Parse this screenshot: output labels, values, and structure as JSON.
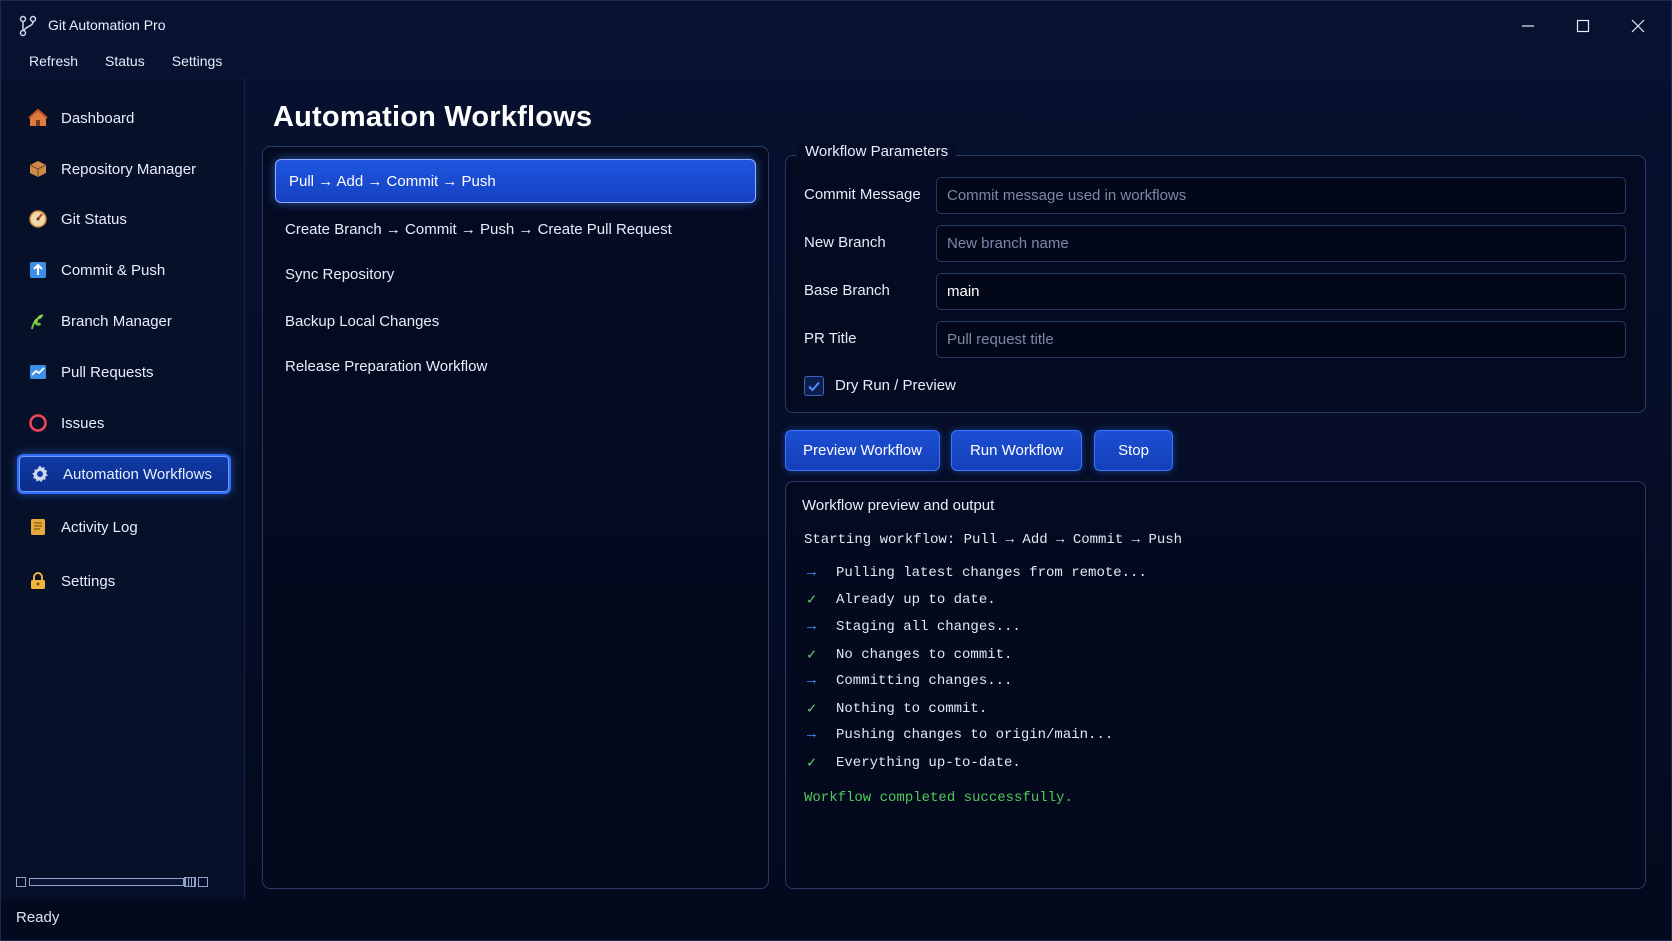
{
  "window": {
    "title": "Git Automation Pro",
    "minimize_icon": "minimize-icon",
    "maximize_icon": "maximize-icon",
    "close_icon": "close-icon"
  },
  "menu": [
    "Refresh",
    "Status",
    "Settings"
  ],
  "sidebar": {
    "items": [
      {
        "label": "Dashboard",
        "icon": "house-icon",
        "active": false
      },
      {
        "label": "Repository Manager",
        "icon": "package-icon",
        "active": false
      },
      {
        "label": "Git Status",
        "icon": "gauge-icon",
        "active": false
      },
      {
        "label": "Commit & Push",
        "icon": "upload-arrow-icon",
        "active": false
      },
      {
        "label": "Branch Manager",
        "icon": "branch-leaf-icon",
        "active": false
      },
      {
        "label": "Pull Requests",
        "icon": "chart-icon",
        "active": false
      },
      {
        "label": "Issues",
        "icon": "circle-icon",
        "active": false
      },
      {
        "label": "Automation Workflows",
        "icon": "gear-icon",
        "active": true
      },
      {
        "label": "Activity Log",
        "icon": "scroll-icon",
        "active": false
      },
      {
        "label": "Settings",
        "icon": "lock-icon",
        "active": false
      }
    ]
  },
  "status": "Ready",
  "main": {
    "title": "Automation Workflows",
    "workflows": [
      "Pull → Add → Commit → Push",
      "Create Branch → Commit → Push → Create Pull Request",
      "Sync Repository",
      "Backup Local Changes",
      "Release Preparation Workflow"
    ],
    "selected_workflow": 0,
    "params": {
      "legend": "Workflow Parameters",
      "commit_message": {
        "label": "Commit Message",
        "value": "",
        "placeholder": "Commit message used in workflows"
      },
      "new_branch": {
        "label": "New Branch",
        "value": "",
        "placeholder": "New branch name"
      },
      "base_branch": {
        "label": "Base Branch",
        "value": "main",
        "placeholder": ""
      },
      "pr_title": {
        "label": "PR Title",
        "value": "",
        "placeholder": "Pull request title"
      },
      "dry_run": {
        "label": "Dry Run / Preview",
        "checked": true
      }
    },
    "buttons": {
      "preview": "Preview Workflow",
      "run": "Run Workflow",
      "stop": "Stop"
    },
    "output": {
      "title": "Workflow preview and output",
      "start_line": "Starting workflow: Pull → Add → Commit → Push",
      "steps": [
        {
          "type": "arrow",
          "text": "Pulling latest changes from remote..."
        },
        {
          "type": "check",
          "text": "Already up to date."
        },
        {
          "type": "arrow",
          "text": "Staging all changes..."
        },
        {
          "type": "check",
          "text": "No changes to commit."
        },
        {
          "type": "arrow",
          "text": "Committing changes..."
        },
        {
          "type": "check",
          "text": "Nothing to commit."
        },
        {
          "type": "arrow",
          "text": "Pushing changes to origin/main..."
        },
        {
          "type": "check",
          "text": "Everything up-to-date."
        }
      ],
      "final": "Workflow completed successfully."
    }
  },
  "colors": {
    "accent": "#1e55e0",
    "success": "#4fc95a",
    "arrow": "#4d8cff",
    "background": "#050a1c"
  }
}
